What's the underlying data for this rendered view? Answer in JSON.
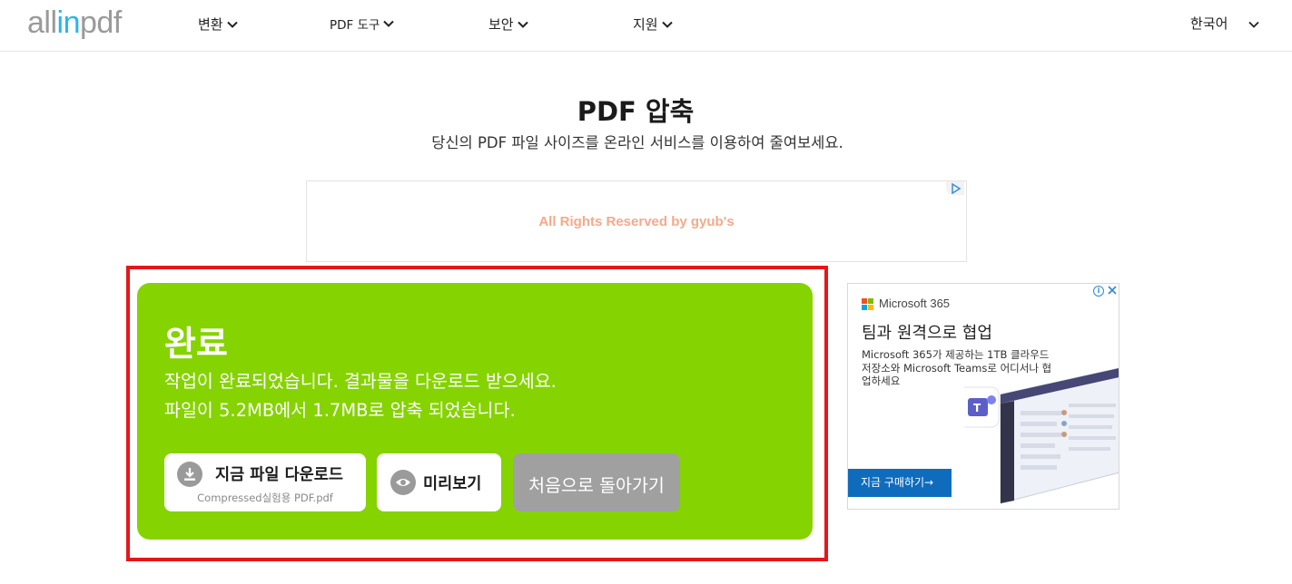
{
  "header": {
    "logo_part1": "all",
    "logo_part2": "in",
    "logo_part3": "pdf",
    "nav": [
      "변환",
      "PDF 도구",
      "보안",
      "지원"
    ],
    "language": "한국어"
  },
  "page": {
    "title": "PDF 압축",
    "subtitle": "당신의 PDF 파일 사이즈를 온라인 서비스를 이용하여 줄여보세요."
  },
  "top_ad": {
    "text": "All Rights Reserved by gyub's"
  },
  "result": {
    "title": "완료",
    "message": "작업이 완료되었습니다. 결과물을 다운로드 받으세요.",
    "compression": "파일이 5.2MB에서 1.7MB로 압축 되었습니다.",
    "download_label": "지금 파일 다운로드",
    "file_name": "Compressed실험용 PDF.pdf",
    "preview_label": "미리보기",
    "restart_label": "처음으로 돌아가기"
  },
  "side_ad": {
    "brand": "Microsoft 365",
    "headline": "팀과 원격으로 협업",
    "body": "Microsoft 365가 제공하는 1TB 클라우드 저장소와 Microsoft Teams로 어디서나 협업하세요",
    "cta": "지금 구매하기→"
  },
  "colors": {
    "panel_green": "#85d300",
    "highlight_red": "#e5161b",
    "logo_blue": "#2bb5e8",
    "cta_blue": "#0f6cbd"
  }
}
